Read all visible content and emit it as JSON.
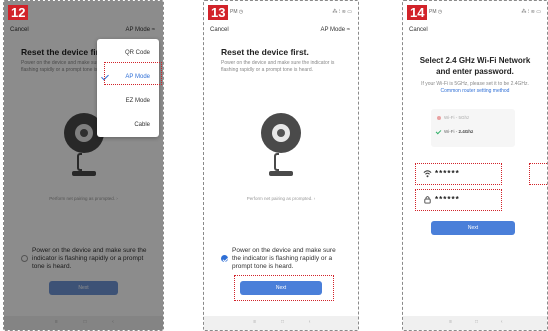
{
  "screens": [
    {
      "step": "12",
      "status_left": "",
      "status_right": "",
      "cancel": "Cancel",
      "mode": "AP Mode ≈",
      "title": "Reset the device first.",
      "desc": "Power on the device and make sure the indicator is flashing rapidly or a prompt tone is heard.",
      "perform": "Perform net pairing as prompted. ›",
      "confirm": "Power on the device and make sure the indicator is flashing rapidly or a prompt tone is heard.",
      "next": "Next",
      "nav": [
        "≡",
        "□",
        "‹"
      ],
      "menu": [
        "QR Code",
        "AP Mode",
        "EZ Mode",
        "Cable"
      ]
    },
    {
      "step": "13",
      "status_left": "PM ◷",
      "status_right": "⁂ ⁝ ≋ ▭",
      "cancel": "Cancel",
      "mode": "AP Mode ≈",
      "title": "Reset the device first.",
      "desc": "Power on the device and make sure the indicator is flashing rapidly or a prompt tone is heard.",
      "perform": "Perform net pairing as prompted. ›",
      "confirm": "Power on the device and make sure the indicator is flashing rapidly or a prompt tone is heard.",
      "next": "Next",
      "nav": [
        "≡",
        "□",
        "‹"
      ]
    },
    {
      "step": "14",
      "status_left": "PM ◷",
      "status_right": "⁂ ⁝ ≋ ▭",
      "cancel": "Cancel",
      "title_line1": "Select 2.4 GHz Wi-Fi Network",
      "title_line2": "and enter password.",
      "desc": "If your Wi-Fi is 5GHz, please set it to be 2.4GHz.",
      "desc_link": "Common router setting method",
      "wifi_5g": "Wi-Fi - 5Ghz",
      "wifi_24g_prefix": "Wi-Fi - ",
      "wifi_24g": "2.4Ghz",
      "ssid_mask": "******",
      "password_mask": "******",
      "next": "Next",
      "nav": [
        "≡",
        "□",
        "‹"
      ]
    }
  ],
  "colors": {
    "badge": "#d2232a",
    "primary": "#4a7fd9",
    "highlight": "#d2232a"
  }
}
